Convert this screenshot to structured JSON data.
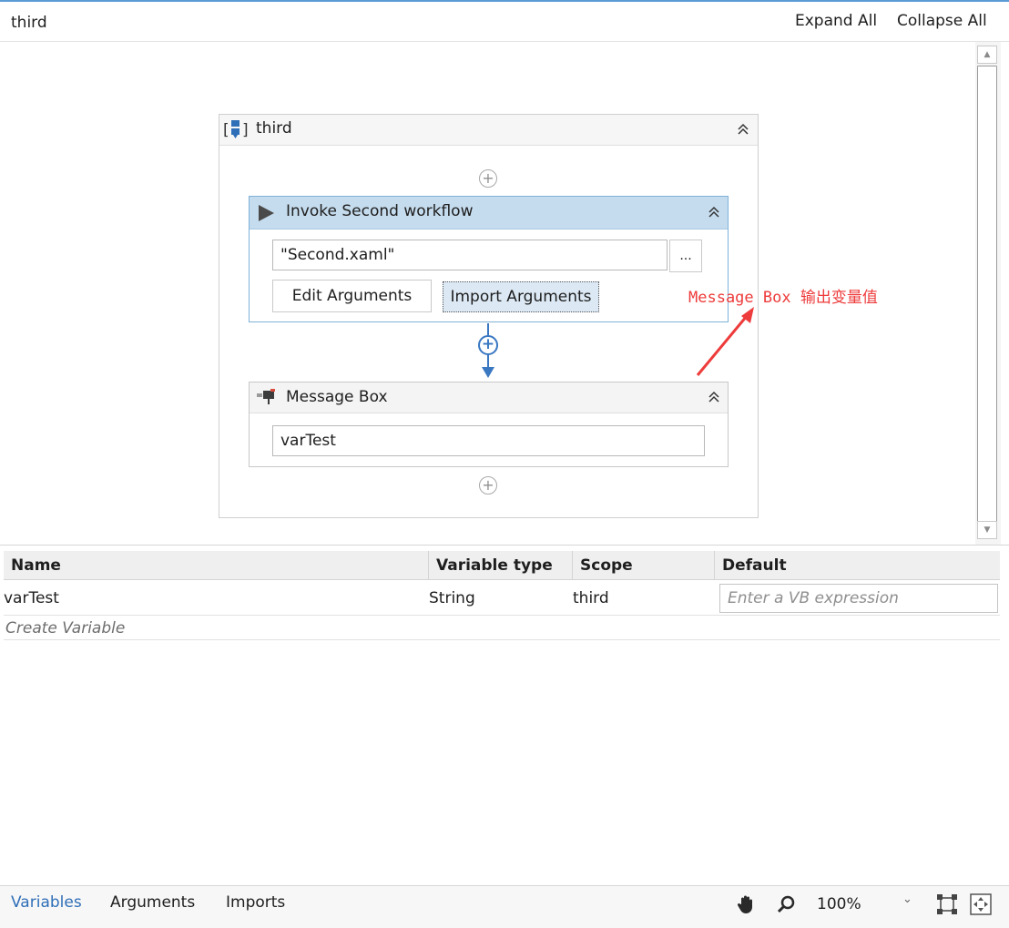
{
  "breadcrumb": {
    "title": "third"
  },
  "toolbar": {
    "expand_all": "Expand All",
    "collapse_all": "Collapse All"
  },
  "sequence": {
    "title": "third",
    "icon": "sequence-icon"
  },
  "invoke_activity": {
    "title": "Invoke Second workflow",
    "icon": "play-triangle-icon",
    "workflow_file": "\"Second.xaml\"",
    "browse_label": "...",
    "edit_args_label": "Edit Arguments",
    "import_args_label": "Import Arguments"
  },
  "message_activity": {
    "title": "Message Box",
    "icon": "message-box-icon",
    "text": "varTest"
  },
  "annotation": {
    "text": "Message Box 输出变量值",
    "color": "#ee3b3b"
  },
  "variables": {
    "columns": [
      "Name",
      "Variable type",
      "Scope",
      "Default"
    ],
    "rows": [
      {
        "name": "varTest",
        "type": "String",
        "scope": "third",
        "default_placeholder": "Enter a VB expression"
      }
    ],
    "create_label": "Create Variable"
  },
  "bottom": {
    "tabs": [
      "Variables",
      "Arguments",
      "Imports"
    ],
    "active_tab": "Variables",
    "zoom": "100%",
    "icons": [
      "hand-pan-icon",
      "zoom-search-icon",
      "fit-to-screen-icon",
      "overview-icon"
    ]
  },
  "colors": {
    "accent": "#2f6fb8",
    "selected_header": "#c5dcee",
    "connector": "#3a78c2"
  }
}
